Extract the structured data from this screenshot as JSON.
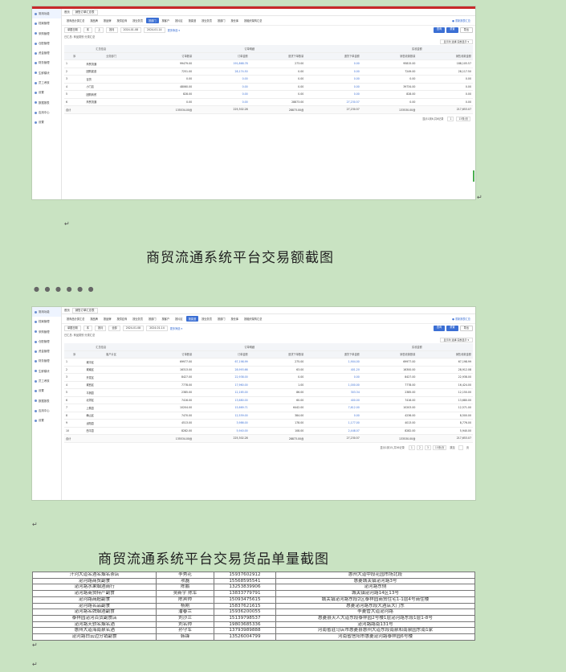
{
  "app": {
    "sidebar": [
      "常用功能",
      "档案管理",
      "采购管理",
      "仓配管理",
      "资金管理",
      "财务管理",
      "生鲜模块",
      "员工考核",
      "设置",
      "数据报表",
      "应用中心",
      "设置"
    ],
    "tab_home": "首页",
    "tab_active": "销售订单汇总表",
    "report_nav": [
      "按商品分类汇总",
      "按品牌",
      "按品牌",
      "按供应商",
      "按业务员",
      "按部门",
      "按客户",
      "按片区",
      "按渠道",
      "按业务员",
      "按部门",
      "按仓库",
      "按组织架构汇总"
    ],
    "report_nav_right": "● 重新报表汇总",
    "filter_label": "单据日期",
    "filter_mode": [
      "本",
      "上",
      "按月",
      "全部"
    ],
    "date_from": "2024-01-08",
    "date_to": "2024-01-14",
    "more_filter": "更多筛选 ▾",
    "btn_search": "查询",
    "btn_reset": "重置",
    "btn_export": "导出",
    "meta_text": "已汇总: 商品类别  分类汇总",
    "column_select": "显示列 选择 完整显示 ▾"
  },
  "shot1": {
    "header_group1": "汇总信息",
    "header_group2": "订单明细",
    "header_group3": "实收金额",
    "columns": [
      "序",
      "业务部门",
      "订单数量",
      "订单金额",
      "退货下单数量",
      "退货下单金额",
      "销售收款数量",
      "销售收款金额"
    ],
    "rows": [
      [
        "1",
        "商贸流通",
        "99479.00",
        "191,868.78",
        "273.00",
        "0.00",
        "95815.00",
        "188,105.57"
      ],
      [
        "2",
        "团购渠道",
        "7251.00",
        "28,174.50",
        "0.00",
        "0.00",
        "7249.00",
        "28,117.50"
      ],
      [
        "3",
        "百货",
        "0.00",
        "0.00",
        "0.00",
        "0.00",
        "0.00",
        "0.00"
      ],
      [
        "4",
        "小门店",
        "48060.00",
        "0.00",
        "0.00",
        "0.00",
        "39734.00",
        "0.00"
      ],
      [
        "5",
        "团购商贸",
        "828.00",
        "0.00",
        "0.00",
        "0.00",
        "828.00",
        "0.00"
      ],
      [
        "6",
        "商贸流通",
        "0.00",
        "0.00",
        "28873.00",
        "27,230.57",
        "0.00",
        "0.00"
      ]
    ],
    "total": [
      "合计",
      "",
      "135534.00台",
      "225,302.28",
      "28873.00台",
      "27,230.57",
      "133530.00台",
      "217,653.07"
    ],
    "pager": "显示1到6,共6记录",
    "page": "1",
    "page_size": "15条/页"
  },
  "caption1": "商贸流通系统平台交易额截图",
  "dots": "● ● ● ● ● ●",
  "shot2": {
    "header_group1": "汇总信息",
    "header_group2": "订单明细",
    "header_group3": "实收金额",
    "columns": [
      "序",
      "客户片区",
      "订单数量",
      "订单金额",
      "退货下单数量",
      "退货下单金额",
      "销售收款数量",
      "销售收款金额"
    ],
    "rows": [
      [
        "1",
        "城中区",
        "69977.00",
        "67,198.99",
        "275.00",
        "1,904.00",
        "69977.00",
        "67,198.99"
      ],
      [
        "2",
        "城南区",
        "16313.00",
        "28,993.66",
        "63.00",
        "401.20",
        "16300.00",
        "28,912.08"
      ],
      [
        "3",
        "开发区",
        "8427.00",
        "22,938.00",
        "0.00",
        "0.00",
        "8427.00",
        "22,938.00"
      ],
      [
        "4",
        "城西区",
        "7778.00",
        "17,960.00",
        "1.00",
        "1,000.00",
        "7778.00",
        "16,424.00"
      ],
      [
        "5",
        "平舆县",
        "2385.00",
        "12,165.00",
        "86.00",
        "303.34",
        "2385.00",
        "12,150.00"
      ],
      [
        "6",
        "北郊区",
        "7416.00",
        "13,680.00",
        "60.00",
        "400.00",
        "7416.00",
        "13,680.00"
      ],
      [
        "7",
        "上蔡县",
        "10204.00",
        "15,669.71",
        "6442.00",
        "7,612.00",
        "10203.00",
        "12,571.00"
      ],
      [
        "8",
        "确山区",
        "7470.00",
        "12,559.00",
        "384.00",
        "0.00",
        "4236.00",
        "8,500.00"
      ],
      [
        "9",
        "泌阳县",
        "4513.00",
        "3,986.00",
        "178.00",
        "1,177.00",
        "4013.00",
        "8,776.00"
      ],
      [
        "10",
        "西平县",
        "8282.00",
        "5,940.00",
        "108.00",
        "2,448.07",
        "8282.00",
        "5,940.00"
      ]
    ],
    "total": [
      "合计",
      "",
      "135534.00台",
      "225,302.28",
      "28873.00台",
      "27,230.57",
      "133530.00台",
      "217,653.07"
    ],
    "pager": "显示1到15,共36记录",
    "pages": [
      "1",
      "2",
      "3"
    ],
    "page_size": "15条/页",
    "goto": "跳至",
    "goto_unit": "页"
  },
  "caption2": "商贸流通系统平台交易货品单量截图",
  "contacts": [
    [
      "汗河大道名酒名烟名茶店",
      "李秀花",
      "15937602912",
      "惠州大道中段花园市场",
      "北段"
    ],
    [
      "泌河路商贸副食",
      "项磊",
      "15568595541",
      "惠菱城关镇泌河路",
      "3号"
    ],
    [
      "泌河路水果烟酒商行",
      "陈鹏",
      "13253839906",
      "泌河路东",
      "侧"
    ],
    [
      "泌河路商贸特产副食",
      "吴新宇 陈军",
      "13833779791",
      "城关镇泌河路14区",
      "13号"
    ],
    [
      "泌河路商超副食",
      "陈宾帅",
      "15093475615",
      "城关镇泌河路东段2区泰祥园",
      "商贸住宅1-1层4号商住楼"
    ],
    [
      "泌河路名品副食",
      "杨刚",
      "15837621615",
      "惠菱泌河路东段大酒店大门",
      "东"
    ],
    [
      "泌河路名牌烟酒副食",
      "潘春兰",
      "15936200055",
      "李菱管大道泌河",
      "路"
    ],
    [
      "泰祥园泌河百货副食店",
      "刘沙兰",
      "15139798537",
      "惠菱县天人大道东段泰祥园",
      "2号楼1层泌河路东段1层1-8号"
    ],
    [
      "泌河路天骄名烟名酒",
      "刘名帅",
      "19803685336",
      "泌河路路南",
      "131号"
    ],
    [
      "惠州大道海南泉名酒",
      "孙守军",
      "13793989888",
      "河南省驻马店市惠菱县惠州大道东段",
      "南泉和南泉园东南1家"
    ],
    [
      "泌河路白云边分销副食",
      "韩锋",
      "13526004799",
      "河南省信阳市惠菱泌河路",
      "泰祥园6号楼"
    ]
  ],
  "contacts_header_hint": ""
}
